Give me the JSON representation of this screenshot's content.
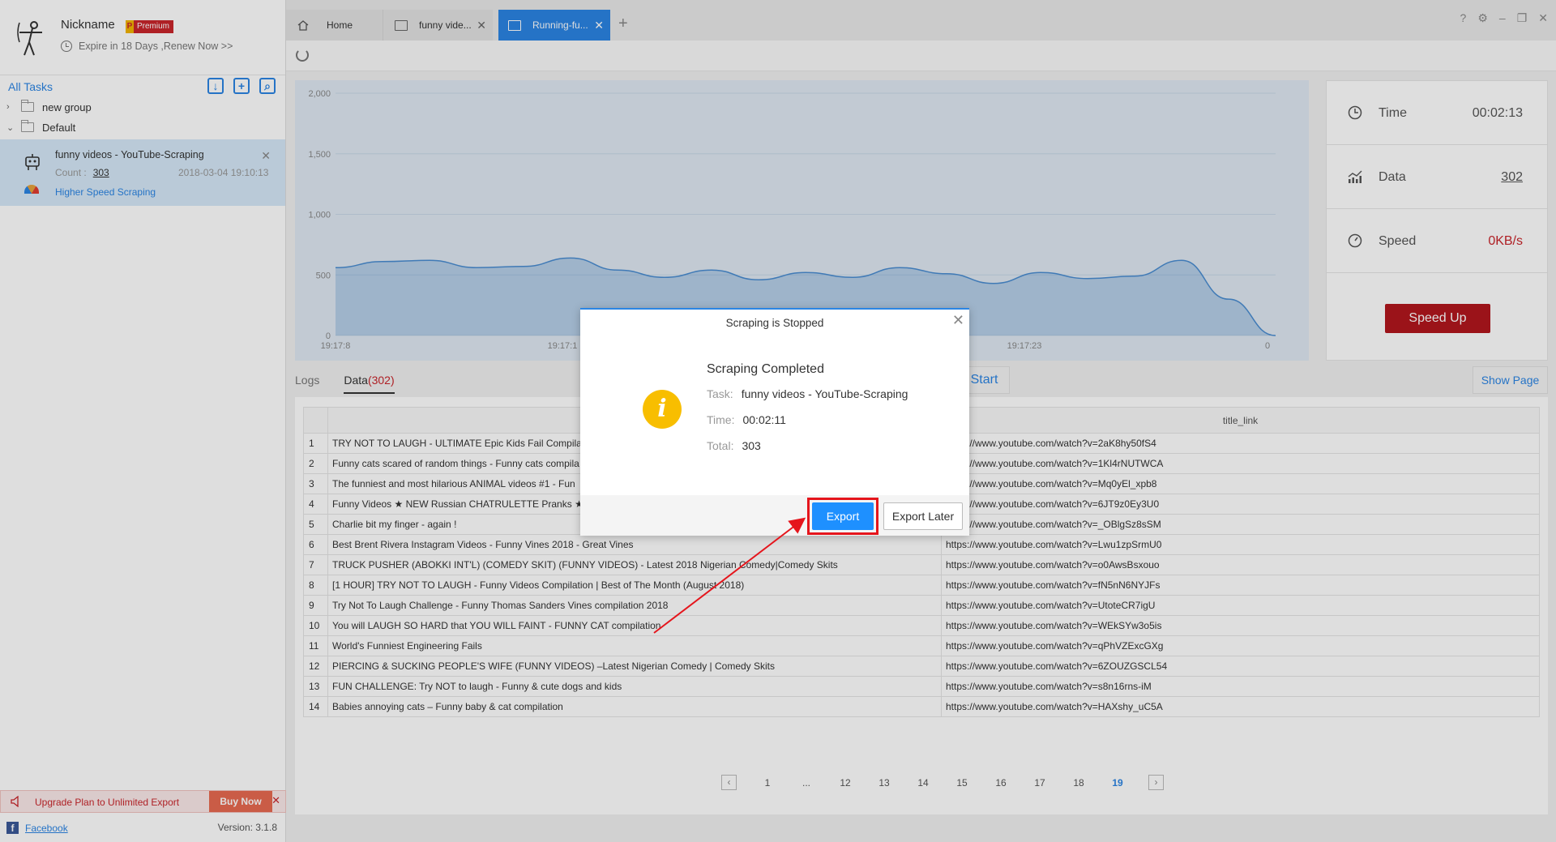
{
  "profile": {
    "nickname": "Nickname",
    "badge": "Premium",
    "expire_text": "Expire in 18 Days ,Renew Now >>"
  },
  "sidebar": {
    "all_tasks": "All Tasks",
    "groups": [
      {
        "label": "new group",
        "expanded": false
      },
      {
        "label": "Default",
        "expanded": true
      }
    ],
    "task": {
      "name": "funny videos - YouTube-Scraping",
      "count_label": "Count :",
      "count_value": "303",
      "date": "2018-03-04 19:10:13",
      "speed_label": "Higher Speed Scraping"
    },
    "upgrade_text": "Upgrade Plan to Unlimited Export",
    "buy_now": "Buy Now",
    "facebook": "Facebook",
    "version": "Version: 3.1.8"
  },
  "tabs": [
    {
      "label": "Home"
    },
    {
      "label": "funny vide..."
    },
    {
      "label": "Running-fu...",
      "active": true
    }
  ],
  "chart_data": {
    "type": "area",
    "yticks": [
      "0",
      "500",
      "1,000",
      "1,500",
      "2,000"
    ],
    "ylim": [
      0,
      2000
    ],
    "xticks": [
      "19:17:8",
      "19:17:1",
      "19:17:23",
      "0"
    ],
    "x": [
      0,
      1,
      2,
      3,
      4,
      5,
      6,
      7,
      8,
      9,
      10,
      11,
      12,
      13,
      14,
      15,
      16,
      17,
      18,
      19,
      20
    ],
    "values": [
      560,
      610,
      620,
      560,
      570,
      640,
      540,
      480,
      540,
      460,
      520,
      480,
      560,
      510,
      430,
      520,
      470,
      490,
      620,
      300,
      0
    ],
    "color": "#4a8dd1"
  },
  "stats": {
    "time_label": "Time",
    "time_value": "00:02:13",
    "data_label": "Data",
    "data_value": "302",
    "speed_label": "Speed",
    "speed_value": "0KB/s",
    "speed_up": "Speed Up"
  },
  "lower_tabs": {
    "logs": "Logs",
    "data": "Data",
    "data_count": "(302)",
    "start": "Start",
    "show_page": "Show Page"
  },
  "table": {
    "columns": [
      "",
      "title_link"
    ],
    "rows": [
      {
        "n": "1",
        "title": "TRY NOT TO LAUGH - ULTIMATE Epic Kids Fail Compila",
        "link": "https://www.youtube.com/watch?v=2aK8hy50fS4"
      },
      {
        "n": "2",
        "title": "Funny cats scared of random things - Funny cats compila",
        "link": "https://www.youtube.com/watch?v=1Kl4rNUTWCA"
      },
      {
        "n": "3",
        "title": "The funniest and most hilarious ANIMAL videos #1 - Fun",
        "link": "https://www.youtube.com/watch?v=Mq0yEl_xpb8"
      },
      {
        "n": "4",
        "title": "Funny Videos ★ NEW Russian CHATRULETTE Pranks ★",
        "link": "https://www.youtube.com/watch?v=6JT9z0Ey3U0"
      },
      {
        "n": "5",
        "title": "Charlie bit my finger - again !",
        "link": "https://www.youtube.com/watch?v=_OBlgSz8sSM"
      },
      {
        "n": "6",
        "title": "Best Brent Rivera Instagram Videos - Funny Vines 2018 - Great Vines",
        "link": "https://www.youtube.com/watch?v=Lwu1zpSrmU0"
      },
      {
        "n": "7",
        "title": "TRUCK PUSHER (ABOKKI INT'L) (COMEDY SKIT) (FUNNY VIDEOS) - Latest 2018 Nigerian Comedy|Comedy Skits",
        "link": "https://www.youtube.com/watch?v=o0AwsBsxouo"
      },
      {
        "n": "8",
        "title": "[1 HOUR] TRY NOT TO LAUGH - Funny Videos Compilation | Best of The Month (August 2018)",
        "link": "https://www.youtube.com/watch?v=fN5nN6NYJFs"
      },
      {
        "n": "9",
        "title": "Try Not To Laugh Challenge - Funny Thomas Sanders Vines compilation 2018",
        "link": "https://www.youtube.com/watch?v=UtoteCR7igU"
      },
      {
        "n": "10",
        "title": "You will LAUGH SO HARD that YOU WILL FAINT - FUNNY CAT compilation",
        "link": "https://www.youtube.com/watch?v=WEkSYw3o5is"
      },
      {
        "n": "11",
        "title": "World's Funniest Engineering Fails",
        "link": "https://www.youtube.com/watch?v=qPhVZExcGXg"
      },
      {
        "n": "12",
        "title": "PIERCING & SUCKING PEOPLE'S WIFE (FUNNY VIDEOS) –Latest Nigerian Comedy | Comedy Skits",
        "link": "https://www.youtube.com/watch?v=6ZOUZGSCL54"
      },
      {
        "n": "13",
        "title": "FUN CHALLENGE: Try NOT to laugh - Funny & cute dogs and kids",
        "link": "https://www.youtube.com/watch?v=s8n16rns-iM"
      },
      {
        "n": "14",
        "title": "Babies annoying cats – Funny baby & cat compilation",
        "link": "https://www.youtube.com/watch?v=HAXshy_uC5A"
      }
    ]
  },
  "pager": {
    "pages": [
      "1",
      "...",
      "12",
      "13",
      "14",
      "15",
      "16",
      "17",
      "18",
      "19"
    ],
    "current": "19"
  },
  "dialog": {
    "title": "Scraping is Stopped",
    "heading": "Scraping Completed",
    "task_key": "Task:",
    "task_value": "funny videos - YouTube-Scraping",
    "time_key": "Time:",
    "time_value": "00:02:11",
    "total_key": "Total:",
    "total_value": "303",
    "export": "Export",
    "export_later": "Export Later",
    "highlight_color": "#e5151c"
  }
}
